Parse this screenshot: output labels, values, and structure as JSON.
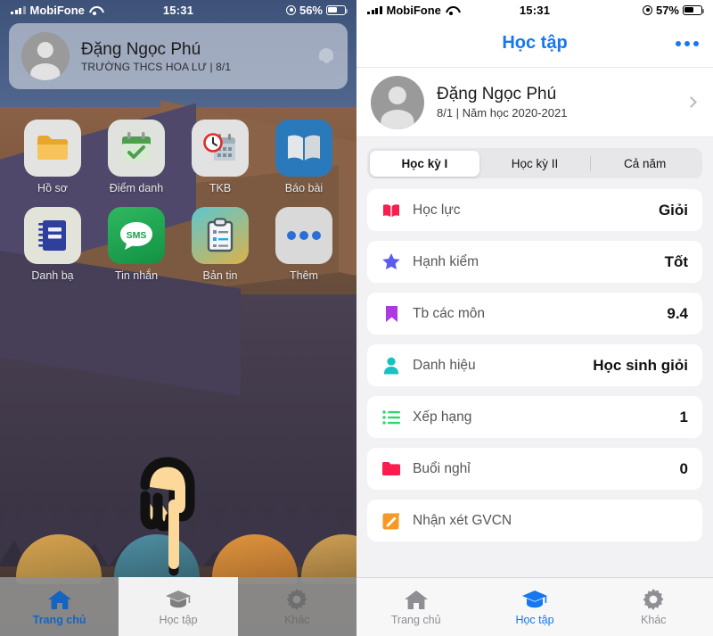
{
  "left_phone": {
    "status_bar": {
      "carrier": "MobiFone",
      "time": "15:31",
      "battery_percent": "56%",
      "signal_icon": "cellular-signal-icon",
      "wifi_icon": "wifi-icon",
      "rotation_lock_icon": "rotation-lock-icon",
      "battery_icon": "battery-icon"
    },
    "profile_card": {
      "name": "Đặng Ngọc Phú",
      "subtitle": "TRƯỜNG THCS HOA LƯ | 8/1",
      "avatar_icon": "avatar",
      "bell_icon": "bell-icon"
    },
    "apps": [
      {
        "label": "Hồ sơ",
        "icon": "folder-icon"
      },
      {
        "label": "Điểm danh",
        "icon": "calendar-check-icon"
      },
      {
        "label": "TKB",
        "icon": "clock-calendar-icon"
      },
      {
        "label": "Báo bài",
        "icon": "open-book-icon"
      },
      {
        "label": "Danh bạ",
        "icon": "notebook-icon"
      },
      {
        "label": "Tin nhắn",
        "icon": "sms-bubble-icon"
      },
      {
        "label": "Bản tin",
        "icon": "clipboard-icon"
      },
      {
        "label": "Thêm",
        "icon": "ellipsis-icon"
      }
    ],
    "tabs": [
      {
        "label": "Trang chủ",
        "icon": "home-icon",
        "state": "active"
      },
      {
        "label": "Học tập",
        "icon": "graduation-cap-icon",
        "state": "pressed"
      },
      {
        "label": "Khác",
        "icon": "gear-icon",
        "state": "normal"
      }
    ],
    "cursor_icon": "pointing-hand-cursor"
  },
  "right_phone": {
    "status_bar": {
      "carrier": "MobiFone",
      "time": "15:31",
      "battery_percent": "57%",
      "signal_icon": "cellular-signal-icon",
      "wifi_icon": "wifi-icon",
      "rotation_lock_icon": "rotation-lock-icon",
      "battery_icon": "battery-icon"
    },
    "navbar": {
      "title": "Học tập",
      "more_icon": "ellipsis-icon"
    },
    "profile_row": {
      "name": "Đặng Ngọc Phú",
      "subtitle": "8/1 | Năm học 2020-2021",
      "avatar_icon": "avatar",
      "chevron_icon": "chevron-right-icon"
    },
    "segments": [
      {
        "label": "Học kỳ I",
        "selected": true
      },
      {
        "label": "Học kỳ II",
        "selected": false
      },
      {
        "label": "Cả năm",
        "selected": false
      }
    ],
    "rows": [
      {
        "label": "Học lực",
        "value": "Giỏi",
        "icon": "open-book-icon",
        "color": "#fa1e50"
      },
      {
        "label": "Hạnh kiểm",
        "value": "Tốt",
        "icon": "star-icon",
        "color": "#5b5bf0"
      },
      {
        "label": "Tb các môn",
        "value": "9.4",
        "icon": "bookmark-icon",
        "color": "#ad3ae0"
      },
      {
        "label": "Danh hiệu",
        "value": "Học sinh giỏi",
        "icon": "person-icon",
        "color": "#16c2c2"
      },
      {
        "label": "Xếp hạng",
        "value": "1",
        "icon": "list-icon",
        "color": "#2ad96a"
      },
      {
        "label": "Buổi nghỉ",
        "value": "0",
        "icon": "folder-icon",
        "color": "#fa1e50"
      },
      {
        "label": "Nhận xét GVCN",
        "value": "",
        "icon": "edit-note-icon",
        "color": "#f79a23"
      }
    ],
    "tabs": [
      {
        "label": "Trang chủ",
        "icon": "home-icon",
        "state": "normal"
      },
      {
        "label": "Học tập",
        "icon": "graduation-cap-icon",
        "state": "active"
      },
      {
        "label": "Khác",
        "icon": "gear-icon",
        "state": "normal"
      }
    ]
  },
  "theme": {
    "accent_blue": "#1677ef",
    "home_tab_blue": "#1565c0",
    "inactive_gray": "#8e8e93",
    "list_bg": "#f2f2f5"
  }
}
